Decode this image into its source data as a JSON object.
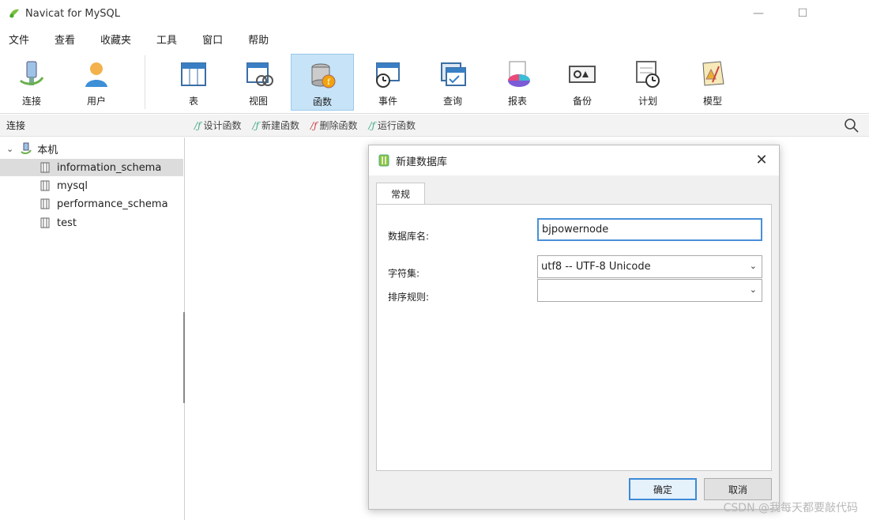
{
  "window": {
    "title": "Navicat for MySQL"
  },
  "menu": [
    "文件",
    "查看",
    "收藏夹",
    "工具",
    "窗口",
    "帮助"
  ],
  "toolbar": {
    "items": [
      {
        "label": "连接",
        "icon": "plug-icon"
      },
      {
        "label": "用户",
        "icon": "user-icon"
      },
      {
        "label": "表",
        "icon": "table-icon"
      },
      {
        "label": "视图",
        "icon": "view-icon"
      },
      {
        "label": "函数",
        "icon": "function-icon",
        "active": true
      },
      {
        "label": "事件",
        "icon": "event-clock-icon"
      },
      {
        "label": "查询",
        "icon": "query-icon"
      },
      {
        "label": "报表",
        "icon": "report-icon"
      },
      {
        "label": "备份",
        "icon": "backup-icon"
      },
      {
        "label": "计划",
        "icon": "schedule-icon"
      },
      {
        "label": "模型",
        "icon": "model-icon"
      }
    ]
  },
  "subbar": {
    "section_label": "连接",
    "actions": [
      "设计函数",
      "新建函数",
      "删除函数",
      "运行函数"
    ]
  },
  "tree": {
    "root": "本机",
    "databases": [
      "information_schema",
      "mysql",
      "performance_schema",
      "test"
    ],
    "selected": "information_schema"
  },
  "dialog": {
    "title": "新建数据库",
    "tab": "常规",
    "db_name_label": "数据库名:",
    "db_name_value": "bjpowernode",
    "charset_label": "字符集:",
    "charset_value": "utf8 -- UTF-8 Unicode",
    "collation_label": "排序规则:",
    "collation_value": "",
    "ok_label": "确定",
    "cancel_label": "取消",
    "close_glyph": "✕"
  },
  "watermark": "CSDN @我每天都要敲代码"
}
